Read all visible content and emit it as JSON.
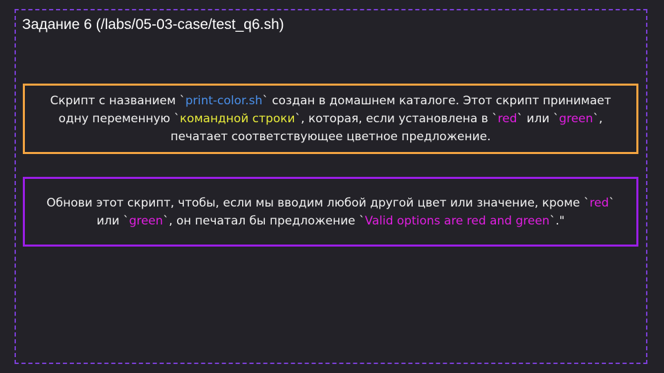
{
  "title": "Задание 6 (/labs/05-03-case/test_q6.sh)",
  "colors": {
    "filename": "#4a8fe8",
    "highlight": "#e8ec3a",
    "value": "#e01ee0",
    "border_orange": "#f2a341",
    "border_purple": "#9a1ee6"
  },
  "task_box": {
    "segments": [
      {
        "text": "Скрипт с названием `",
        "color": ""
      },
      {
        "text": "print-color.sh",
        "color": "#4a8fe8"
      },
      {
        "text": "` создан в домашнем каталоге. Этот скрипт принимает одну переменную `",
        "color": ""
      },
      {
        "text": "командной строки",
        "color": "#e8ec3a"
      },
      {
        "text": "`, которая, если установлена в `",
        "color": ""
      },
      {
        "text": "red",
        "color": "#e01ee0"
      },
      {
        "text": "` или `",
        "color": ""
      },
      {
        "text": "green",
        "color": "#e01ee0"
      },
      {
        "text": "`, печатает соответствующее цветное предложение.",
        "color": ""
      }
    ]
  },
  "instruction_box": {
    "segments": [
      {
        "text": "Обнови этот скрипт, чтобы, если мы вводим любой другой цвет или значение, кроме `",
        "color": ""
      },
      {
        "text": "red",
        "color": "#e01ee0"
      },
      {
        "text": "` или `",
        "color": ""
      },
      {
        "text": "green",
        "color": "#e01ee0"
      },
      {
        "text": "`, он печатал бы предложение `",
        "color": ""
      },
      {
        "text": "Valid options are red and green",
        "color": "#e01ee0"
      },
      {
        "text": "`.\"",
        "color": ""
      }
    ]
  }
}
